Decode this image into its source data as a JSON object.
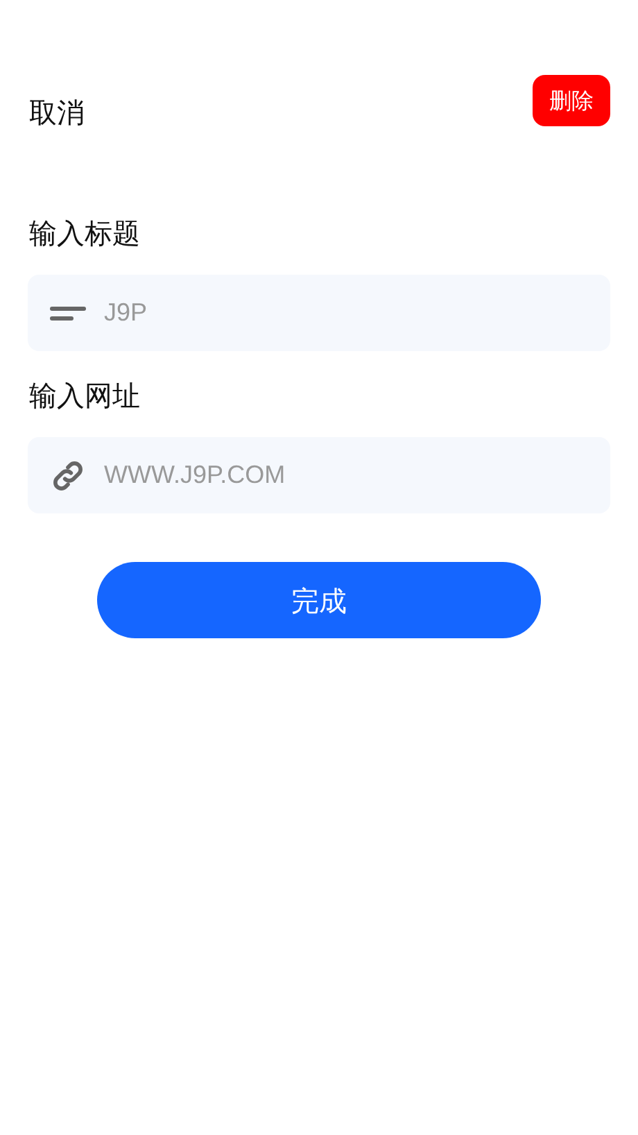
{
  "header": {
    "cancel": "取消",
    "delete": "删除"
  },
  "fields": [
    {
      "label": "输入标题",
      "kind": "title",
      "placeholder": "J9P"
    },
    {
      "label": "输入网址",
      "kind": "link",
      "placeholder": "WWW.J9P.COM"
    }
  ],
  "submit": "完成"
}
